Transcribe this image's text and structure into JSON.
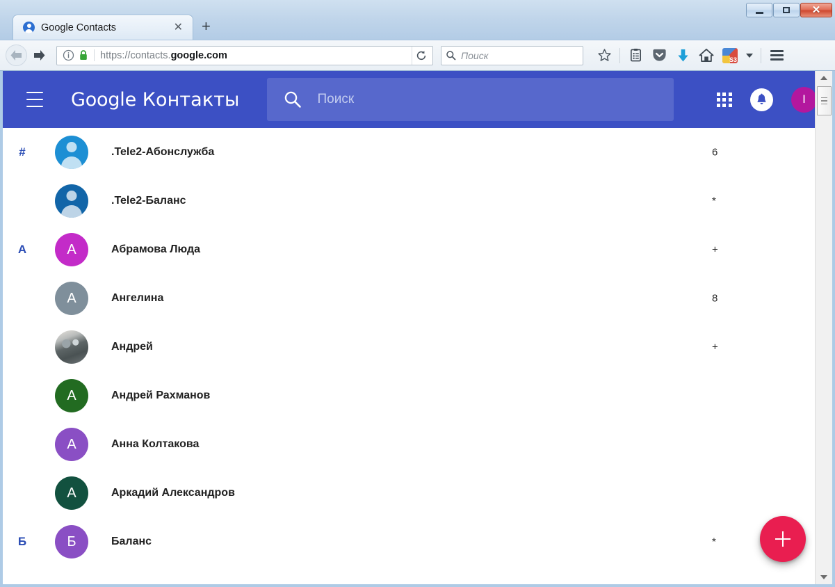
{
  "browser": {
    "window_controls": {
      "minimize": "–",
      "maximize": "□",
      "close": "✕"
    },
    "tab": {
      "title": "Google Contacts",
      "favicon": "contact-person-favicon",
      "close_label": "✕"
    },
    "new_tab_label": "+",
    "nav": {
      "back_label": "back-arrow",
      "forward_label": "forward-arrow",
      "reload_label": "reload"
    },
    "url": {
      "scheme_path": "https://contacts.",
      "domain": "google.com",
      "identity_icon": "info-circle-icon",
      "security_icon": "green-padlock-icon"
    },
    "search": {
      "placeholder": "Поиск"
    },
    "toolbar_icons": [
      "star-icon",
      "library-icon",
      "pocket-icon",
      "downloads-icon",
      "home-icon",
      "extension-icon",
      "overflow-chevron-icon",
      "menu-hamburger-icon"
    ]
  },
  "app": {
    "menu_label": "menu-hamburger",
    "brand_google": "Google",
    "brand_product": "Контакты",
    "search": {
      "placeholder": "Поиск",
      "icon": "search-icon"
    },
    "apps_icon": "apps-grid-icon",
    "notifications_icon": "bell-icon",
    "account_initial": "I",
    "account_color": "#b3179e",
    "bar_color": "#3c50c4"
  },
  "contacts": [
    {
      "section": "#",
      "name": ".Tele2-Абонслужба",
      "avatar_type": "person",
      "avatar_color": "#1d8fd4",
      "initial": "",
      "phone_fragment": "6"
    },
    {
      "section": "",
      "name": ".Tele2-Баланс",
      "avatar_type": "person",
      "avatar_color": "#1265a8",
      "initial": "",
      "phone_fragment": "*"
    },
    {
      "section": "А",
      "name": "Абрамова Люда",
      "avatar_type": "initial",
      "avatar_color": "#c32bc8",
      "initial": "А",
      "phone_fragment": "+"
    },
    {
      "section": "",
      "name": "Ангелина",
      "avatar_type": "initial",
      "avatar_color": "#7f8f9b",
      "initial": "А",
      "phone_fragment": "8"
    },
    {
      "section": "",
      "name": "Андрей",
      "avatar_type": "photo",
      "avatar_color": "#5d6566",
      "initial": "",
      "phone_fragment": "+"
    },
    {
      "section": "",
      "name": "Андрей Рахманов",
      "avatar_type": "initial",
      "avatar_color": "#226b21",
      "initial": "А",
      "phone_fragment": ""
    },
    {
      "section": "",
      "name": "Анна Колтакова",
      "avatar_type": "initial",
      "avatar_color": "#8a4fc4",
      "initial": "А",
      "phone_fragment": ""
    },
    {
      "section": "",
      "name": "Аркадий Александров",
      "avatar_type": "initial",
      "avatar_color": "#12513f",
      "initial": "А",
      "phone_fragment": ""
    },
    {
      "section": "Б",
      "name": "Баланс",
      "avatar_type": "initial",
      "avatar_color": "#8a4fc4",
      "initial": "Б",
      "phone_fragment": "*"
    }
  ],
  "fab": {
    "label": "+",
    "name": "add-contact-button",
    "color": "#e91e50"
  },
  "scrollbar": {
    "up_label": "scroll-up",
    "down_label": "scroll-down"
  }
}
